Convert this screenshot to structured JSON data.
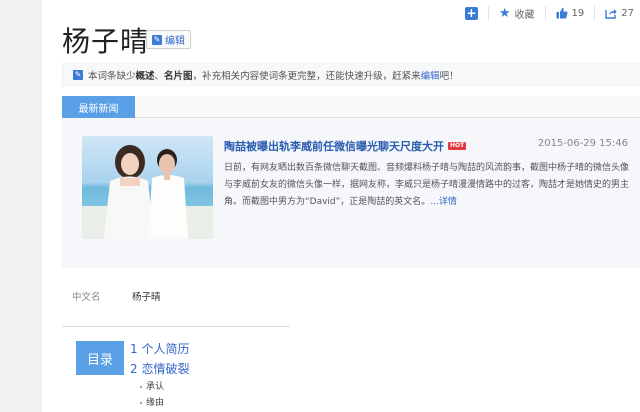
{
  "toolbar": {
    "collect_label": "收藏",
    "like_count": "19",
    "share_count": "27"
  },
  "header": {
    "title": "杨子晴",
    "edit_label": "编辑"
  },
  "notice": {
    "prefix": "本词条缺少",
    "item1": "概述",
    "sep": "、",
    "item2": "名片图",
    "middle": "，补充相关内容使词条更完整，还能快速升级，赶紧来",
    "link": "编辑",
    "suffix": "吧！"
  },
  "news": {
    "tab_label": "最新新闻",
    "title": "陶喆被曝出轨李威前任微信曝光聊天尺度大开",
    "hot_badge": "HOT",
    "date": "2015-06-29 15:46",
    "body": "日前，有网友晒出数百条微信聊天截图、音频爆料杨子晴与陶喆的风流韵事，截图中杨子晴的微信头像与李威前女友的微信头像一样，据网友称，李威只是杨子晴漫漫情路中的过客，陶喆才是她情史的男主角。而截图中男方为“David”，正是陶喆的英文名。",
    "more": "...详情"
  },
  "basic_info": {
    "label": "中文名",
    "value": "杨子晴"
  },
  "toc": {
    "badge": "目录",
    "items": [
      {
        "num": "1",
        "label": "个人简历"
      },
      {
        "num": "2",
        "label": "恋情破裂"
      }
    ],
    "subitems": [
      "承认",
      "缘由"
    ]
  },
  "colors": {
    "accent": "#5aa0e6",
    "link": "#3366cc",
    "hot": "#e4393c"
  }
}
